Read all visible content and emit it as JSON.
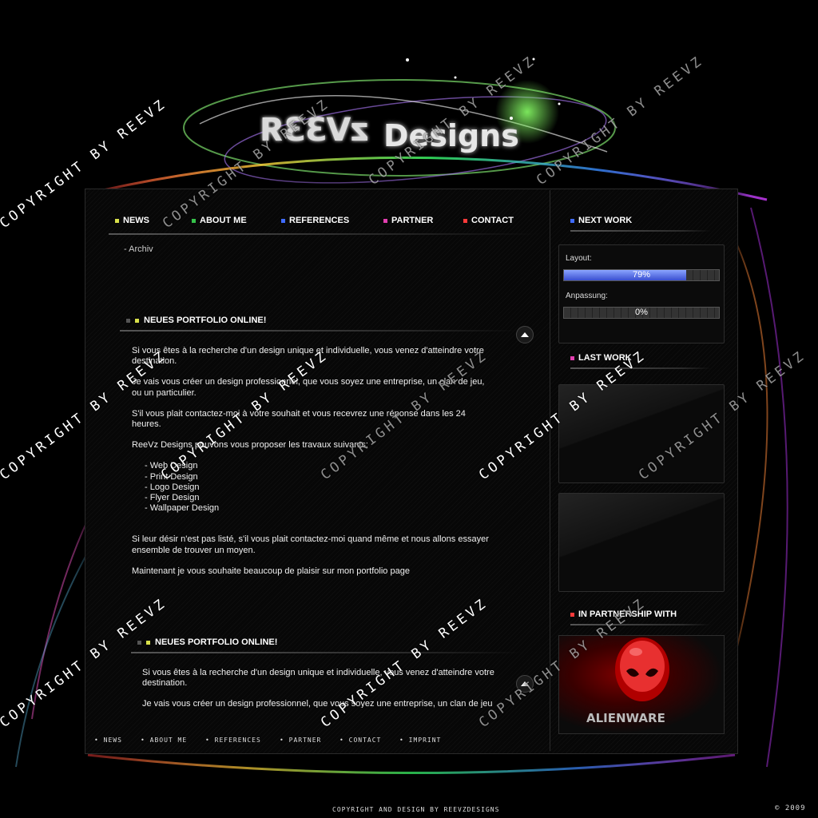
{
  "logo": {
    "left_text": "zV33Я",
    "right_text": "Designs"
  },
  "nav": [
    {
      "label": "NEWS",
      "color": "#d8e04a"
    },
    {
      "label": "ABOUT ME",
      "color": "#35c24a"
    },
    {
      "label": "REFERENCES",
      "color": "#3f6bff"
    },
    {
      "label": "PARTNER",
      "color": "#e23fb0"
    },
    {
      "label": "CONTACT",
      "color": "#ff3a3a"
    }
  ],
  "archiv": "- Archiv",
  "articles": [
    {
      "title": "NEUES PORTFOLIO ONLINE!",
      "p1": "Si vous êtes à la recherche d'un design unique et individuelle, vous venez d'atteindre votre destination.",
      "p2": "Je vais vous créer un design professionnel, que vous soyez une entreprise, un clan de jeu, ou un particulier.",
      "p3": "S'il vous plait contactez-moi à votre souhait et vous recevrez une réponse dans les 24 heures.",
      "p4": "ReeVz Designs pouvons vous proposer les travaux suivants:",
      "list": [
        "Web Design",
        "Print Design",
        "Logo Design",
        "Flyer Design",
        "Wallpaper Design"
      ],
      "p5": "Si leur désir n'est pas listé, s'il vous plait contactez-moi quand même et nous allons essayer ensemble de trouver un moyen.",
      "p6": "Maintenant je vous souhaite beaucoup de plaisir sur mon portfolio page"
    },
    {
      "title": "NEUES PORTFOLIO ONLINE!",
      "p1": "Si vous êtes à la recherche d'un design unique et individuelle, vous venez d'atteindre votre destination.",
      "p2": "Je vais vous créer un design professionnel, que vous soyez une entreprise, un clan de jeu"
    }
  ],
  "sidebar": {
    "next_work": {
      "title": "NEXT WORK",
      "color": "#3f6bff",
      "layout_label": "Layout:",
      "layout_value": 0.79,
      "layout_text": "79%",
      "anpassung_label": "Anpassung:",
      "anpassung_value": 0,
      "anpassung_text": "0%"
    },
    "last_work": {
      "title": "LAST WORK",
      "color": "#e23fb0"
    },
    "partnership": {
      "title": "IN PARTNERSHIP WITH",
      "color": "#ff3a3a",
      "partner_name": "ALIENWARE"
    }
  },
  "footer_nav": [
    "NEWS",
    "ABOUT ME",
    "REFERENCES",
    "PARTNER",
    "CONTACT",
    "IMPRINT"
  ],
  "footer_copyright": "COPYRIGHT AND DESIGN BY REEVZDESIGNS",
  "footer_year": "© 2009",
  "watermark": "COPYRIGHT BY REEVZ"
}
